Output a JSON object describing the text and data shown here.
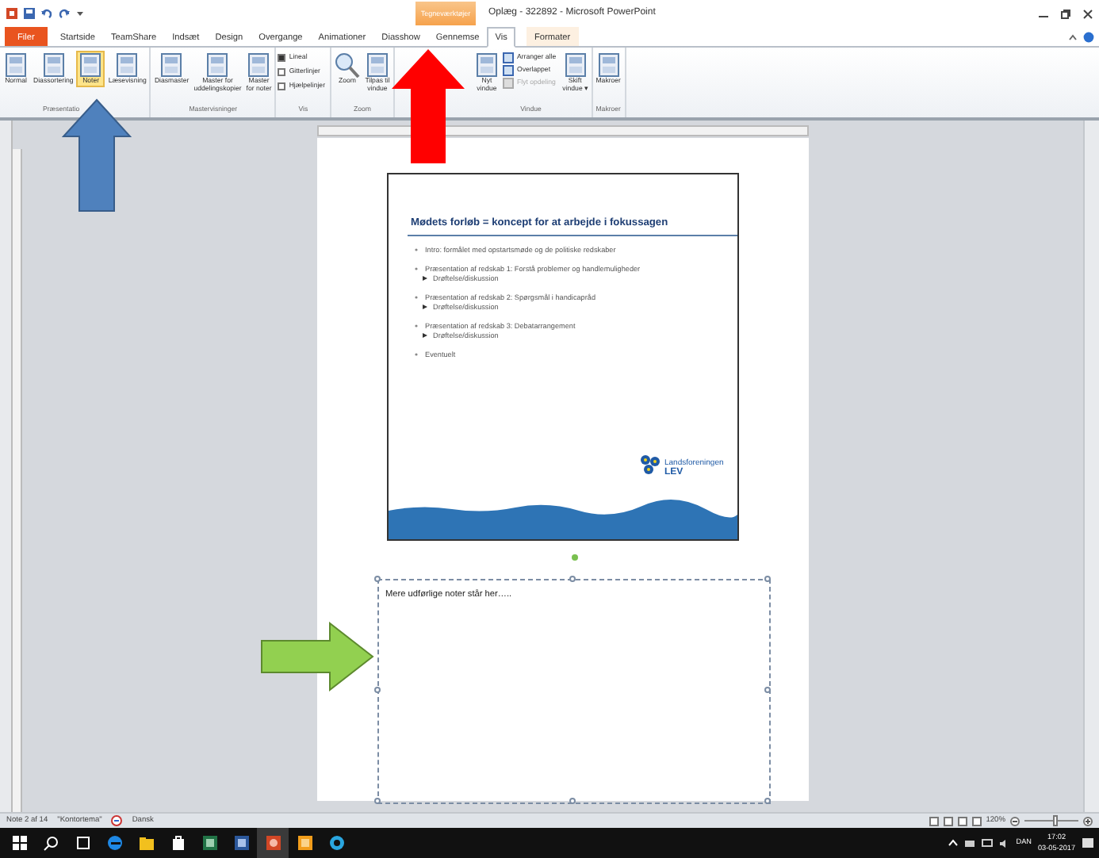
{
  "window": {
    "title": "Oplæg - 322892 - Microsoft PowerPoint",
    "context_header": "Tegneværktøjer"
  },
  "tabs": [
    {
      "label": "Filer",
      "kind": "file",
      "selected": false
    },
    {
      "label": "Startside",
      "kind": "plain",
      "selected": false
    },
    {
      "label": "TeamShare",
      "kind": "plain",
      "selected": false
    },
    {
      "label": "Indsæt",
      "kind": "plain",
      "selected": false
    },
    {
      "label": "Design",
      "kind": "plain",
      "selected": false
    },
    {
      "label": "Overgange",
      "kind": "plain",
      "selected": false
    },
    {
      "label": "Animationer",
      "kind": "plain",
      "selected": false
    },
    {
      "label": "Diasshow",
      "kind": "plain",
      "selected": false
    },
    {
      "label": "Gennemse",
      "kind": "plain",
      "selected": false
    },
    {
      "label": "Vis",
      "kind": "plain",
      "selected": true
    },
    {
      "label": "Formater",
      "kind": "context",
      "selected": false
    }
  ],
  "ribbon_groups": [
    {
      "label": "Præsentatio",
      "items": [
        {
          "kind": "large",
          "label": "Normal",
          "selected": false
        },
        {
          "kind": "large",
          "label": "Diassortering",
          "selected": false
        },
        {
          "kind": "large",
          "label": "Noter",
          "selected": true
        },
        {
          "kind": "large",
          "label": "Læsevisning",
          "selected": false
        }
      ]
    },
    {
      "label": "Mastervisninger",
      "items": [
        {
          "kind": "large",
          "label": "Diasmaster",
          "selected": false
        },
        {
          "kind": "large",
          "label": "Master for\nuddelingskopier",
          "selected": false
        },
        {
          "kind": "large",
          "label": "Master\nfor noter",
          "selected": false
        }
      ]
    },
    {
      "label": "Vis",
      "items": [
        {
          "kind": "check",
          "label": "Lineal",
          "checked": true
        },
        {
          "kind": "check",
          "label": "Gitterlinjer",
          "checked": false
        },
        {
          "kind": "check",
          "label": "Hjælpelinjer",
          "checked": false
        }
      ]
    },
    {
      "label": "Zoom",
      "items": [
        {
          "kind": "zoom",
          "label": "Zoom",
          "selected": false
        },
        {
          "kind": "large",
          "label": "Tilpas til\nvindue",
          "selected": false
        }
      ]
    },
    {
      "label": "Vindue",
      "items": [
        {
          "kind": "large",
          "label": "Nyt\nvindue",
          "selected": false
        },
        {
          "kind": "small",
          "label": "Arranger alle",
          "disabled": false
        },
        {
          "kind": "small",
          "label": "Overlappet",
          "disabled": false
        },
        {
          "kind": "small",
          "label": "Flyt opdeling",
          "disabled": true
        },
        {
          "kind": "large",
          "label": "Skift\nvindue ▾",
          "selected": false
        }
      ]
    },
    {
      "label": "Makroer",
      "items": [
        {
          "kind": "large",
          "label": "Makroer",
          "selected": false
        }
      ]
    }
  ],
  "slide": {
    "title": "Mødets forløb = koncept for at arbejde i fokussagen",
    "bullets": [
      {
        "text": "Intro: formålet med opstartsmøde og de politiske redskaber"
      },
      {
        "text": "Præsentation af redskab 1: Forstå problemer og handlemuligheder",
        "children": [
          {
            "text": "Drøftelse/diskussion"
          }
        ]
      },
      {
        "text": "Præsentation af redskab 2: Spørgsmål i handicapråd",
        "children": [
          {
            "text": "Drøftelse/diskussion"
          }
        ]
      },
      {
        "text": "Præsentation af redskab 3: Debatarrangement",
        "children": [
          {
            "text": "Drøftelse/diskussion"
          }
        ]
      },
      {
        "text": "Eventuelt"
      }
    ],
    "logo": {
      "line_1": "Landsforeningen",
      "line_2": "LEV"
    }
  },
  "notes": {
    "text": "Mere udførlige noter står her….."
  },
  "status_bar": {
    "slide": "Note 2 af 14",
    "theme": "\"Kontortema\"",
    "language": "Dansk",
    "zoom": "120%",
    "zoom_slider": {
      "level": 0.6
    }
  },
  "taskbar": {
    "apps": [
      {
        "kind": "start",
        "active": false
      },
      {
        "kind": "search",
        "active": false
      },
      {
        "kind": "taskview",
        "active": false
      },
      {
        "kind": "edge",
        "active": false
      },
      {
        "kind": "folder",
        "active": false
      },
      {
        "kind": "store",
        "active": false
      },
      {
        "kind": "excel",
        "active": false
      },
      {
        "kind": "word",
        "active": false
      },
      {
        "kind": "powerpoint",
        "active": true
      },
      {
        "kind": "orange",
        "active": false
      },
      {
        "kind": "ie",
        "active": false
      }
    ],
    "language": "DAN",
    "time": "17:02",
    "date": "03-05-2017"
  }
}
